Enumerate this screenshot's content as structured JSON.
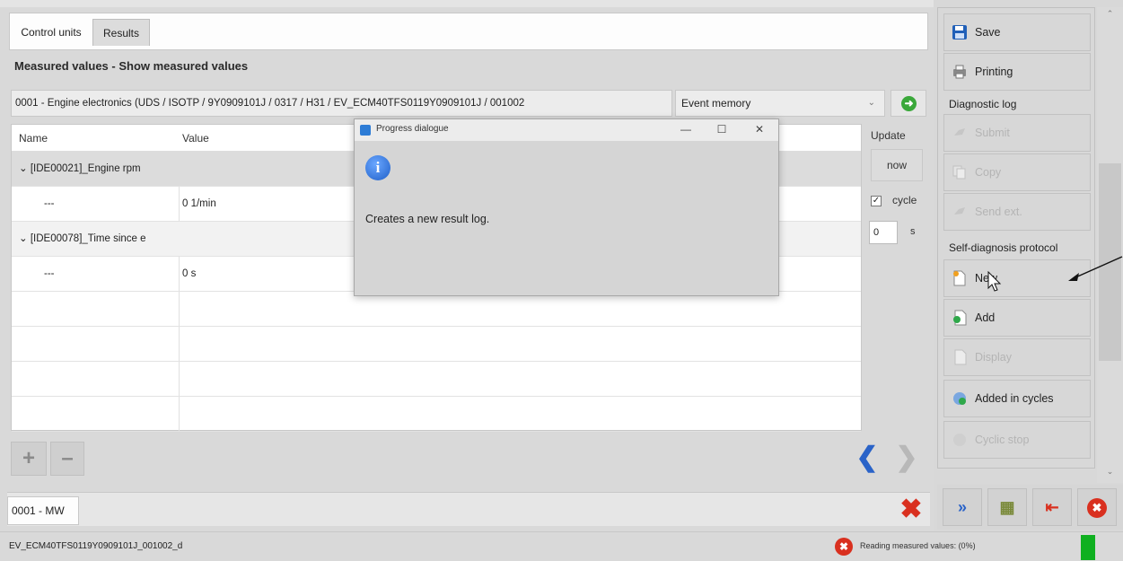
{
  "tabs": {
    "control_units": "Control units",
    "results": "Results"
  },
  "section_title": "Measured values - Show measured values",
  "control_unit_field": "0001 - Engine electronics  (UDS / ISOTP / 9Y0909101J / 0317 / H31 / EV_ECM40TFS0119Y0909101J / 001002",
  "event_select": {
    "value": "Event memory"
  },
  "table": {
    "headers": {
      "name": "Name",
      "value": "Value"
    },
    "rows": [
      {
        "name": "[IDE00021]_Engine rpm",
        "value": ""
      },
      {
        "name": "---",
        "value": "0 1/min"
      },
      {
        "name": "[IDE00078]_Time since e",
        "value": ""
      },
      {
        "name": "---",
        "value": "0 s"
      }
    ]
  },
  "update_panel": {
    "label": "Update",
    "now_button": "now",
    "cycle_label": "cycle",
    "cycle_value": "0",
    "cycle_unit": "s"
  },
  "bottom_tab": "0001 - MW",
  "status_bar": {
    "left_text": "EV_ECM40TFS0119Y0909101J_001002_d",
    "right_text": "Reading measured values: (0%)"
  },
  "right_panel": {
    "save": "Save",
    "printing": "Printing",
    "diagnostic_log_label": "Diagnostic log",
    "submit": "Submit",
    "copy": "Copy",
    "send_ext": "Send ext.",
    "self_diagnosis_label": "Self-diagnosis protocol",
    "new": "New",
    "add": "Add",
    "display": "Display",
    "added_in_cycles": "Added in cycles",
    "cyclic_stop": "Cyclic stop"
  },
  "dialog": {
    "title": "Progress dialogue",
    "message": "Creates a new result log."
  },
  "colors": {
    "accent_blue": "#2a63c8",
    "error_red": "#d9301f",
    "progress_green": "#0fb020"
  }
}
